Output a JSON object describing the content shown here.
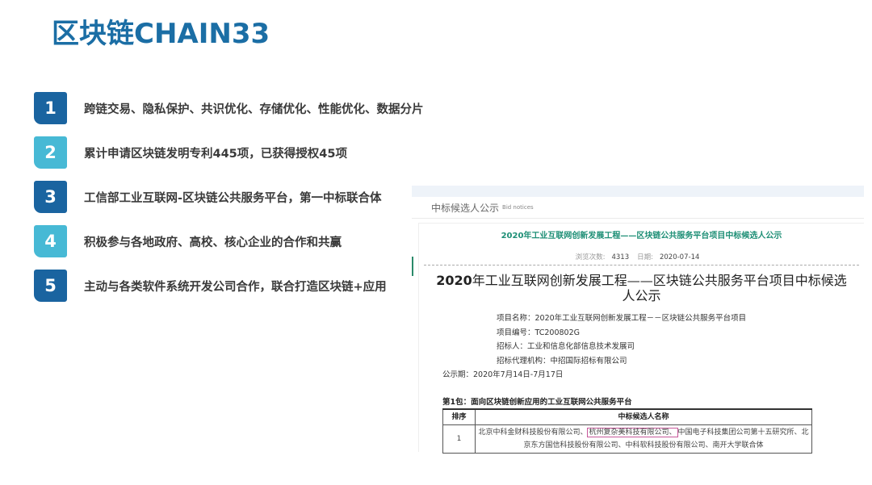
{
  "title": "区块链CHAIN33",
  "items": [
    {
      "num": "1",
      "text": "跨链交易、隐私保护、共识优化、存储优化、性能优化、数据分片"
    },
    {
      "num": "2",
      "text": "累计申请区块链发明专利445项，已获得授权45项"
    },
    {
      "num": "3",
      "text": "工信部工业互联网-区块链公共服务平台，第一中标联合体"
    },
    {
      "num": "4",
      "text": "积极参与各地政府、高校、核心企业的合作和共赢"
    },
    {
      "num": "5",
      "text": "主动与各类软件系统开发公司合作，联合打造区块链+应用"
    }
  ],
  "screenshot": {
    "section": "中标候选人公示",
    "section_en": "Bid notices",
    "green_title": "2020年工业互联网创新发展工程——区块链公共服务平台项目中标候选人公示",
    "views_label": "浏览次数:",
    "views": "4313",
    "date_label": "日期:",
    "date": "2020-07-14",
    "big_title_year": "2020",
    "big_title": "年工业互联网创新发展工程——区块链公共服务平台项目中标候选人公示",
    "info": [
      "项目名称：2020年工业互联网创新发展工程－－区块链公共服务平台项目",
      "项目编号：TC200802G",
      "招标人：工业和信息化部信息技术发展司",
      "招标代理机构：中招国际招标有限公司"
    ],
    "period": "公示期：2020年7月14日-7月17日",
    "package": "第1包：面向区块链创新应用的工业互联网公共服务平台",
    "table": {
      "headers": [
        "排序",
        "中标候选人名称"
      ],
      "row": {
        "rank": "1",
        "part1": "北京中科金财科技股份有限公司、",
        "highlight": "杭州复杂美科技有限公司、",
        "part2": "中国电子科技集团公司第十五研究所、北京东方国信科技股份有限公司、中科软科技股份有限公司、南开大学联合体"
      }
    }
  }
}
